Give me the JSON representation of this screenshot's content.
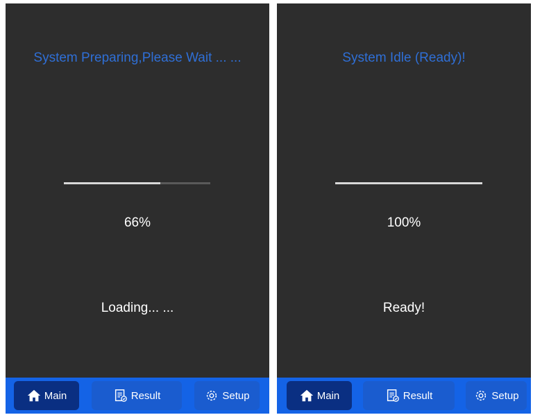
{
  "colors": {
    "title": "#2f6fd6",
    "panel": "#2d2d2d",
    "navbar": "#1463e6",
    "nav_active": "#0a2f82"
  },
  "screens": [
    {
      "title": "System Preparing,Please Wait ... ...",
      "progress_fraction": 0.66,
      "percent_text": "66%",
      "status": "Loading... ...",
      "nav": {
        "main": "Main",
        "result": "Result",
        "setup": "Setup",
        "active": "main"
      }
    },
    {
      "title": "System Idle (Ready)!",
      "progress_fraction": 1.0,
      "percent_text": "100%",
      "status": "Ready!",
      "nav": {
        "main": "Main",
        "result": "Result",
        "setup": "Setup",
        "active": "main"
      }
    }
  ],
  "icons": {
    "main": "home-icon",
    "result": "result-icon",
    "setup": "gear-icon"
  }
}
